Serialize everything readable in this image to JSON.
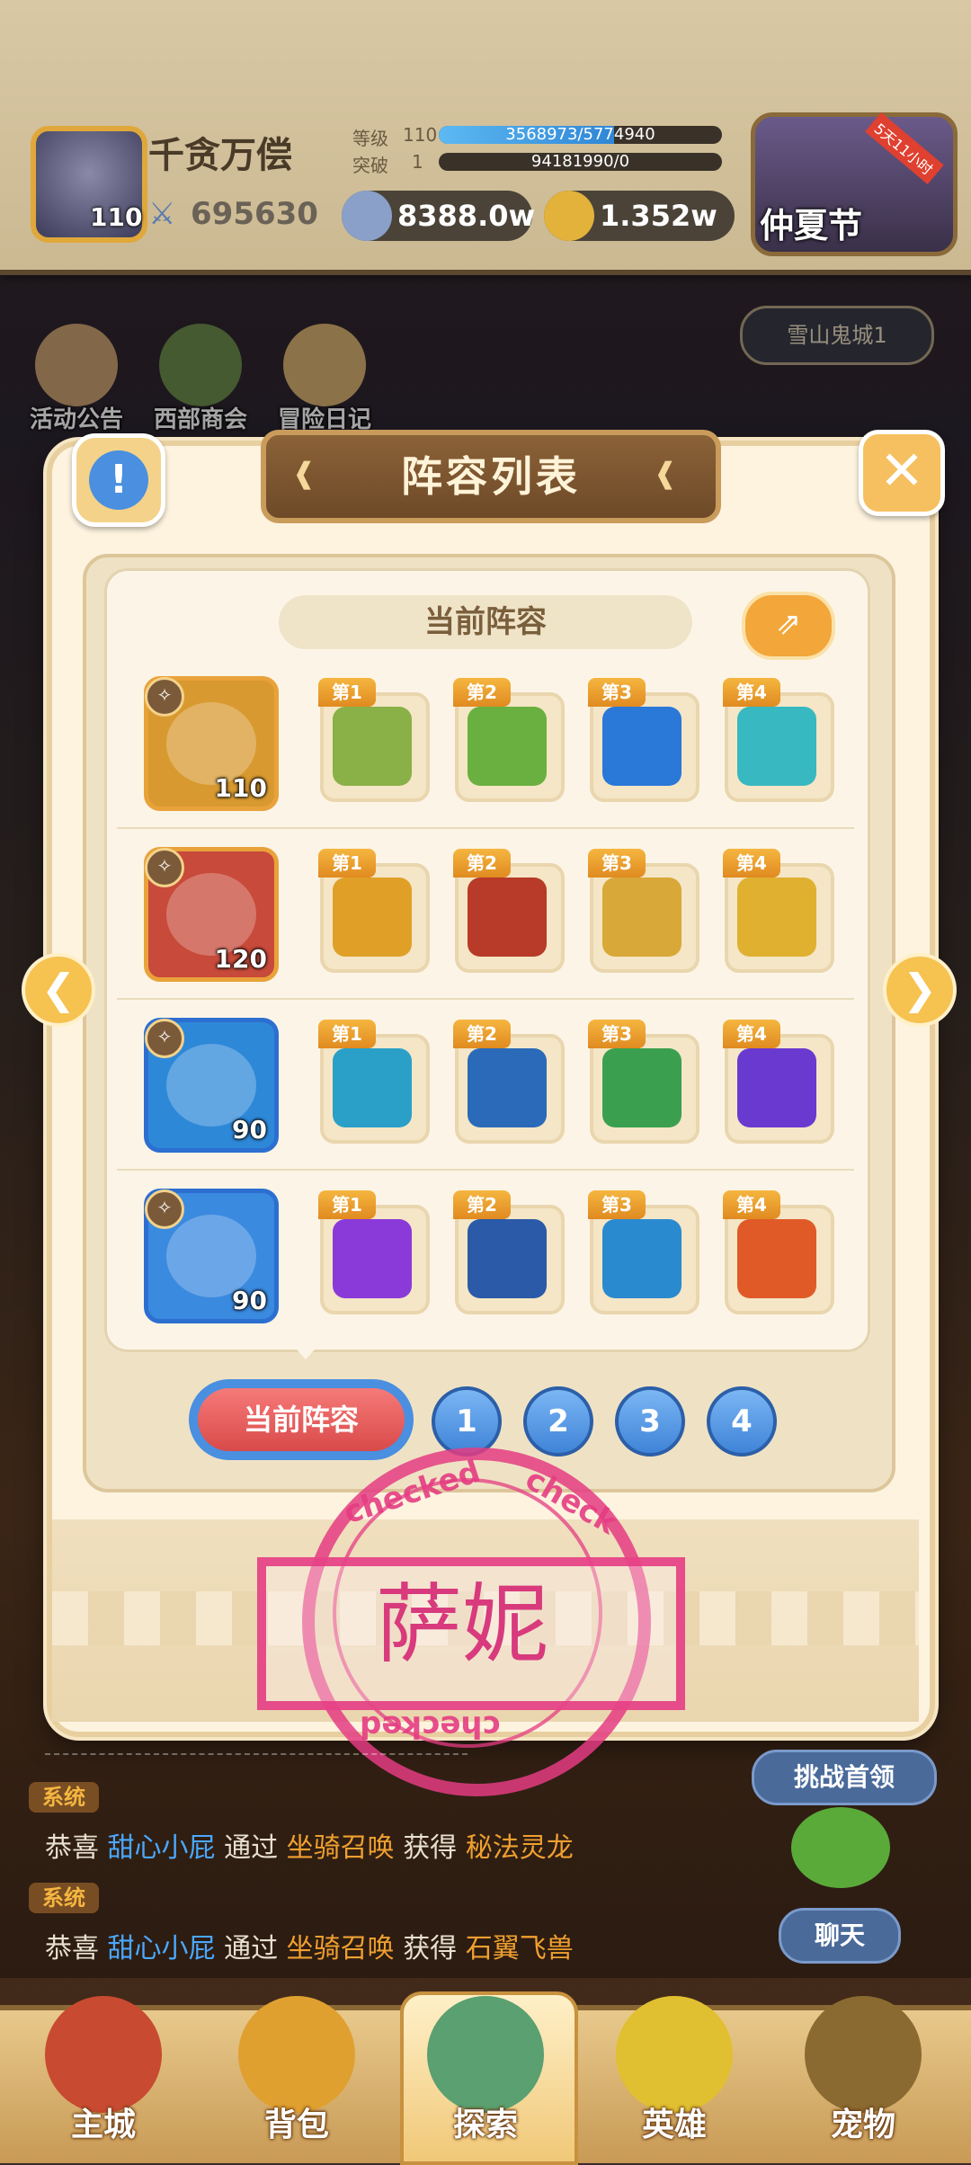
{
  "player": {
    "name": "千贪万偿",
    "level": "110",
    "power": "695630",
    "rank_label": "等级",
    "rank_value": "110",
    "exp_text": "3568973/5774940",
    "exp_progress": 0.62,
    "break_label": "突破",
    "break_value": "1",
    "break_text": "94181990/0",
    "break_progress": 0
  },
  "currencies": [
    {
      "name": "silver",
      "icon": "coin-icon",
      "value": "8388.0w",
      "color": "#8aa0c8"
    },
    {
      "name": "gold",
      "icon": "gold-coin-icon",
      "value": "1.352w",
      "color": "#e2b23a"
    }
  ],
  "event": {
    "label": "仲夏节",
    "badge": "5天11小时"
  },
  "quick_menu": [
    {
      "label": "活动公告",
      "icon": "notice-board-icon"
    },
    {
      "label": "西部商会",
      "icon": "merchant-icon"
    },
    {
      "label": "冒险日记",
      "icon": "diary-icon"
    }
  ],
  "location": "雪山鬼城1",
  "panel": {
    "title": "阵容列表",
    "current_label": "当前阵容",
    "close_icon": "close-icon",
    "info_icon": "info-icon",
    "share_icon": "share-icon"
  },
  "team": [
    {
      "level": "110",
      "hero_icon": "armored-duck-hero-icon",
      "frame_color": "#e9a23a",
      "bg": "#d89a30",
      "skills": [
        {
          "tag": "第1",
          "icon": "lightning-arrow-skill-icon",
          "color": "#8ab048"
        },
        {
          "tag": "第2",
          "icon": "star-shield-skill-icon",
          "color": "#6ab040"
        },
        {
          "tag": "第3",
          "icon": "wind-blade-skill-icon",
          "color": "#2a78d8"
        },
        {
          "tag": "第4",
          "icon": "ghost-skill-icon",
          "color": "#38b8c0"
        }
      ]
    },
    {
      "level": "120",
      "hero_icon": "skull-dragon-hero-icon",
      "frame_color": "#e9a23a",
      "bg": "#c84a3a",
      "skills": [
        {
          "tag": "第1",
          "icon": "serpent-skill-icon",
          "color": "#e0a028"
        },
        {
          "tag": "第2",
          "icon": "dragon-eye-skill-icon",
          "color": "#b83a28"
        },
        {
          "tag": "第3",
          "icon": "monkey-strike-skill-icon",
          "color": "#d8a838"
        },
        {
          "tag": "第4",
          "icon": "golden-dragon-skill-icon",
          "color": "#e0b030"
        }
      ]
    },
    {
      "level": "90",
      "hero_icon": "tree-creature-hero-icon",
      "frame_color": "#2c6fd0",
      "bg": "#2e88d8",
      "skills": [
        {
          "tag": "第1",
          "icon": "leaf-skill-icon",
          "color": "#2aa0c8"
        },
        {
          "tag": "第2",
          "icon": "tree-guardian-skill-icon",
          "color": "#2a6ab8"
        },
        {
          "tag": "第3",
          "icon": "flower-bulb-skill-icon",
          "color": "#3aa050"
        },
        {
          "tag": "第4",
          "icon": "purple-rain-skill-icon",
          "color": "#6a3ad0"
        }
      ]
    },
    {
      "level": "90",
      "hero_icon": "armored-pig-hero-icon",
      "frame_color": "#2c6fd0",
      "bg": "#3a8ae0",
      "skills": [
        {
          "tag": "第1",
          "icon": "arcane-circle-skill-icon",
          "color": "#8a3ad8"
        },
        {
          "tag": "第2",
          "icon": "red-mask-skill-icon",
          "color": "#2a5aa8"
        },
        {
          "tag": "第3",
          "icon": "ice-staff-skill-icon",
          "color": "#2a8ad0"
        },
        {
          "tag": "第4",
          "icon": "fist-skill-icon",
          "color": "#e05a28"
        }
      ]
    }
  ],
  "tabs": {
    "current": "当前阵容",
    "numbers": [
      "1",
      "2",
      "3",
      "4"
    ]
  },
  "stamp": {
    "top_text": "checked",
    "top_text2": "check",
    "bottom_text": "checked",
    "name": "萨妮"
  },
  "chat": [
    {
      "tag": "系统",
      "p1": "恭喜",
      "player": "甜心小屁",
      "p2": "通过",
      "source": "坐骑召唤",
      "p3": "获得",
      "reward": "秘法灵龙"
    },
    {
      "tag": "系统",
      "p1": "恭喜",
      "player": "甜心小屁",
      "p2": "通过",
      "source": "坐骑召唤",
      "p3": "获得",
      "reward": "石翼飞兽"
    }
  ],
  "side_buttons": {
    "challenge": "挑战首领",
    "chat": "聊天"
  },
  "bottom_nav": [
    {
      "label": "主城",
      "icon": "castle-icon",
      "color": "#c84a30"
    },
    {
      "label": "背包",
      "icon": "backpack-icon",
      "color": "#e0a030"
    },
    {
      "label": "探索",
      "icon": "map-scroll-icon",
      "color": "#5aa070"
    },
    {
      "label": "英雄",
      "icon": "hero-face-icon",
      "color": "#e0c030"
    },
    {
      "label": "宠物",
      "icon": "pet-egg-icon",
      "color": "#8a6a30"
    }
  ]
}
